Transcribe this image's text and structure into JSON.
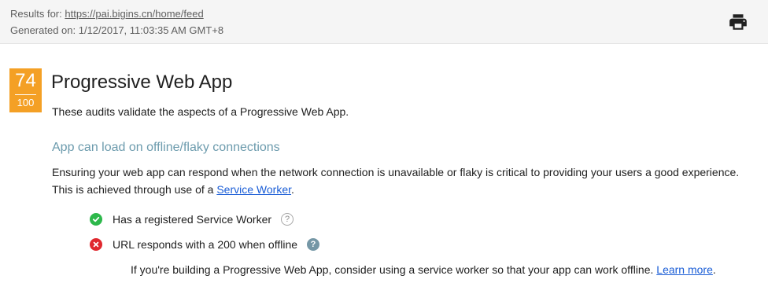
{
  "header": {
    "results_label": "Results for: ",
    "url": "https://pai.bigins.cn/home/feed",
    "generated": "Generated on: 1/12/2017, 11:03:35 AM GMT+8",
    "print_icon": "printer-icon"
  },
  "score": {
    "value": "74",
    "total": "100",
    "color": "#f4a025"
  },
  "section": {
    "title": "Progressive Web App",
    "description": "These audits validate the aspects of a Progressive Web App.",
    "subheading": "App can load on offline/flaky connections",
    "paragraph_before": "Ensuring your web app can respond when the network connection is unavailable or flaky is critical to providing your users a good experience. This is achieved through use of a ",
    "paragraph_link": "Service Worker",
    "paragraph_after": "."
  },
  "audits": [
    {
      "status": "pass",
      "status_icon": "check-icon",
      "label": "Has a registered Service Worker",
      "help_icon": "?"
    },
    {
      "status": "fail",
      "status_icon": "cross-icon",
      "label": "URL responds with a 200 when offline",
      "help_icon": "?",
      "helptext_before": "If you're building a Progressive Web App, consider using a service worker so that your app can work offline. ",
      "helptext_link": "Learn more",
      "helptext_after": "."
    }
  ],
  "colors": {
    "pass": "#2db84b",
    "fail": "#e0282e",
    "subheading": "#6c9bad",
    "link": "#1a5dd6"
  }
}
